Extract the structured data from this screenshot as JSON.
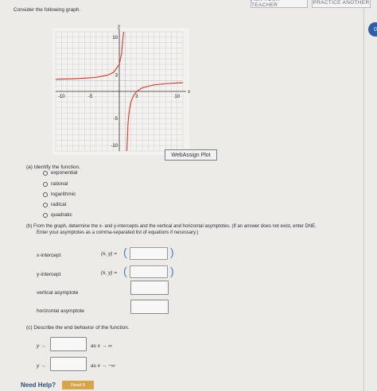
{
  "header": {
    "ask_label": "ASK YOUR TEACHER",
    "practice_label": "PRACTICE ANOTHER",
    "badge": "0"
  },
  "intro": "Consider the following graph.",
  "graph": {
    "x_axis_label": "x",
    "y_axis_label": "y",
    "x_ticks": [
      "-10",
      "-5",
      "3",
      "10"
    ],
    "y_ticks": [
      "10",
      "3",
      "-5",
      "-10"
    ],
    "curve_color": "#d9432f",
    "webassign_plot_label": "WebAssign Plot"
  },
  "chart_data": {
    "type": "line",
    "title": "",
    "xlabel": "x",
    "ylabel": "y",
    "xlim": [
      -11,
      11
    ],
    "ylim": [
      -11,
      11
    ],
    "grid": true,
    "vertical_asymptote": 1,
    "horizontal_asymptote": 2,
    "series": [
      {
        "x": [
          -11,
          -10,
          -8,
          -6,
          -4,
          -2,
          -1,
          0,
          0.4,
          0.6,
          0.75
        ],
        "y": [
          2.25,
          2.27,
          2.33,
          2.43,
          2.6,
          3,
          3.5,
          5,
          7,
          9.5,
          11
        ]
      },
      {
        "x": [
          1.3,
          1.5,
          1.7,
          2,
          2.5,
          3,
          4,
          6,
          8,
          10,
          11
        ],
        "y": [
          -11,
          -6,
          -3.7,
          -2,
          -0.7,
          0,
          0.67,
          1.2,
          1.43,
          1.56,
          1.6
        ]
      }
    ]
  },
  "part_a": {
    "prompt": "(a) Identify the function.",
    "options": [
      "exponential",
      "rational",
      "logarithmic",
      "radical",
      "quadratic"
    ]
  },
  "part_b": {
    "prompt_line1": "(b) From the graph, determine the x- and y-intercepts and the vertical and horizontal asymptotes. (If an answer does not exist, enter DNE.",
    "prompt_line2": "Enter your asymptotes as a comma-separated list of equations if necessary.)",
    "x_intercept_label": "x-intercept",
    "y_intercept_label": "y-intercept",
    "vertical_label": "vertical asymptote",
    "horizontal_label": "horizontal asymptote",
    "xy_prefix": "(x, y) ="
  },
  "part_c": {
    "prompt": "(c) Describe the end behavior of the function.",
    "lhs": "y →",
    "as_pos": "as x → ∞",
    "as_neg": "as x → −∞"
  },
  "footer": {
    "need_help": "Need Help?",
    "read_it": "Read It"
  }
}
